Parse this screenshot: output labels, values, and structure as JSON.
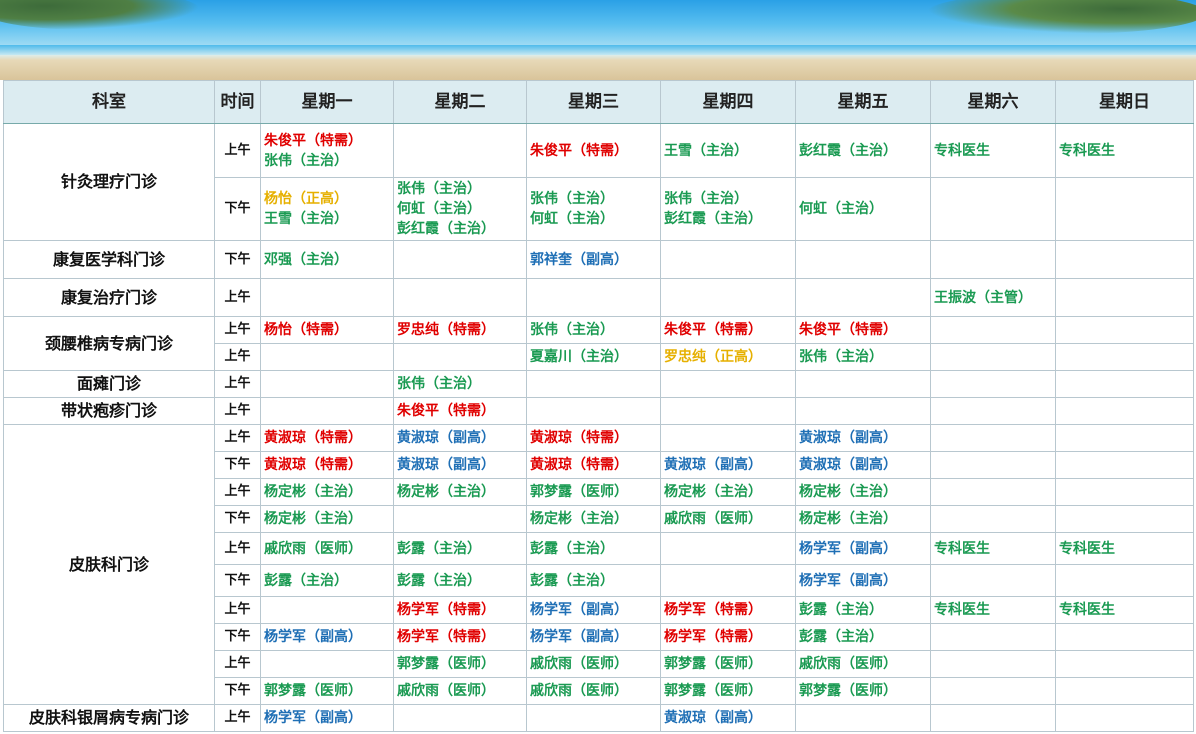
{
  "headers": [
    "科室",
    "时间",
    "星期一",
    "星期二",
    "星期三",
    "星期四",
    "星期五",
    "星期六",
    "星期日"
  ],
  "colors": {
    "red": "#e00000",
    "green": "#1a9a52",
    "blue": "#1f6fb5",
    "gold": "#e6b000",
    "header_bg": "#dcecf1"
  },
  "rows": [
    {
      "dept": "针灸理疗门诊",
      "span": 2,
      "time": "上午",
      "h": 54,
      "cells": [
        [
          [
            "朱俊平（特需）",
            "red"
          ],
          [
            "张伟（主治）",
            "green"
          ]
        ],
        [],
        [
          [
            "朱俊平（特需）",
            "red"
          ]
        ],
        [
          [
            "王雪（主治）",
            "green"
          ]
        ],
        [
          [
            "彭红霞（主治）",
            "green"
          ]
        ],
        [
          [
            "专科医生",
            "green"
          ]
        ],
        [
          [
            "专科医生",
            "green"
          ]
        ]
      ]
    },
    {
      "time": "下午",
      "h": 63,
      "cells": [
        [
          [
            "杨怡（正高）",
            "gold"
          ],
          [
            "王雪（主治）",
            "green"
          ]
        ],
        [
          [
            "张伟（主治）",
            "green"
          ],
          [
            "何虹（主治）",
            "green"
          ],
          [
            "彭红霞（主治）",
            "green"
          ]
        ],
        [
          [
            "张伟（主治）",
            "green"
          ],
          [
            "何虹（主治）",
            "green"
          ]
        ],
        [
          [
            "张伟（主治）",
            "green"
          ],
          [
            "彭红霞（主治）",
            "green"
          ]
        ],
        [
          [
            "何虹（主治）",
            "green"
          ]
        ],
        [],
        []
      ]
    },
    {
      "dept": "康复医学科门诊",
      "span": 1,
      "time": "下午",
      "h": 38,
      "cells": [
        [
          [
            "邓强（主治）",
            "green"
          ]
        ],
        [],
        [
          [
            "郭祥奎（副高）",
            "blue"
          ]
        ],
        [],
        [],
        [],
        []
      ]
    },
    {
      "dept": "康复治疗门诊",
      "span": 1,
      "time": "上午",
      "h": 38,
      "cells": [
        [],
        [],
        [],
        [],
        [],
        [
          [
            "王振波（主管）",
            "green"
          ]
        ],
        []
      ]
    },
    {
      "dept": "颈腰椎病专病门诊",
      "span": 2,
      "time": "上午",
      "h": 27,
      "cells": [
        [
          [
            "杨怡（特需）",
            "red"
          ]
        ],
        [
          [
            "罗忠纯（特需）",
            "red"
          ]
        ],
        [
          [
            "张伟（主治）",
            "green"
          ]
        ],
        [
          [
            "朱俊平（特需）",
            "red"
          ]
        ],
        [
          [
            "朱俊平（特需）",
            "red"
          ]
        ],
        [],
        []
      ]
    },
    {
      "time": "上午",
      "h": 27,
      "cells": [
        [],
        [],
        [
          [
            "夏嘉川（主治）",
            "green"
          ]
        ],
        [
          [
            "罗忠纯（正高）",
            "gold"
          ]
        ],
        [
          [
            "张伟（主治）",
            "green"
          ]
        ],
        [],
        []
      ]
    },
    {
      "dept": "面瘫门诊",
      "span": 1,
      "time": "上午",
      "h": 27,
      "cells": [
        [],
        [
          [
            "张伟（主治）",
            "green"
          ]
        ],
        [],
        [],
        [],
        [],
        []
      ]
    },
    {
      "dept": "带状疱疹门诊",
      "span": 1,
      "time": "上午",
      "h": 27,
      "cells": [
        [],
        [
          [
            "朱俊平（特需）",
            "red"
          ]
        ],
        [],
        [],
        [],
        [],
        []
      ]
    },
    {
      "dept": "皮肤科门诊",
      "span": 10,
      "time": "上午",
      "h": 27,
      "cells": [
        [
          [
            "黄淑琼（特需）",
            "red"
          ]
        ],
        [
          [
            "黄淑琼（副高）",
            "blue"
          ]
        ],
        [
          [
            "黄淑琼（特需）",
            "red"
          ]
        ],
        [],
        [
          [
            "黄淑琼（副高）",
            "blue"
          ]
        ],
        [],
        []
      ]
    },
    {
      "time": "下午",
      "h": 27,
      "cells": [
        [
          [
            "黄淑琼（特需）",
            "red"
          ]
        ],
        [
          [
            "黄淑琼（副高）",
            "blue"
          ]
        ],
        [
          [
            "黄淑琼（特需）",
            "red"
          ]
        ],
        [
          [
            "黄淑琼（副高）",
            "blue"
          ]
        ],
        [
          [
            "黄淑琼（副高）",
            "blue"
          ]
        ],
        [],
        []
      ]
    },
    {
      "time": "上午",
      "h": 27,
      "cells": [
        [
          [
            "杨定彬（主治）",
            "green"
          ]
        ],
        [
          [
            "杨定彬（主治）",
            "green"
          ]
        ],
        [
          [
            "郭梦露（医师）",
            "green"
          ]
        ],
        [
          [
            "杨定彬（主治）",
            "green"
          ]
        ],
        [
          [
            "杨定彬（主治）",
            "green"
          ]
        ],
        [],
        []
      ]
    },
    {
      "time": "下午",
      "h": 27,
      "cells": [
        [
          [
            "杨定彬（主治）",
            "green"
          ]
        ],
        [],
        [
          [
            "杨定彬（主治）",
            "green"
          ]
        ],
        [
          [
            "戚欣雨（医师）",
            "green"
          ]
        ],
        [
          [
            "杨定彬（主治）",
            "green"
          ]
        ],
        [],
        []
      ]
    },
    {
      "time": "上午",
      "h": 32,
      "cells": [
        [
          [
            "戚欣雨（医师）",
            "green"
          ]
        ],
        [
          [
            "彭露（主治）",
            "green"
          ]
        ],
        [
          [
            "彭露（主治）",
            "green"
          ]
        ],
        [],
        [
          [
            "杨学军（副高）",
            "blue"
          ]
        ],
        [
          [
            "专科医生",
            "green"
          ]
        ],
        [
          [
            "专科医生",
            "green"
          ]
        ]
      ]
    },
    {
      "time": "下午",
      "h": 32,
      "cells": [
        [
          [
            "彭露（主治）",
            "green"
          ]
        ],
        [
          [
            "彭露（主治）",
            "green"
          ]
        ],
        [
          [
            "彭露（主治）",
            "green"
          ]
        ],
        [],
        [
          [
            "杨学军（副高）",
            "blue"
          ]
        ],
        [],
        []
      ]
    },
    {
      "time": "上午",
      "h": 27,
      "cells": [
        [],
        [
          [
            "杨学军（特需）",
            "red"
          ]
        ],
        [
          [
            "杨学军（副高）",
            "blue"
          ]
        ],
        [
          [
            "杨学军（特需）",
            "red"
          ]
        ],
        [
          [
            "彭露（主治）",
            "green"
          ]
        ],
        [
          [
            "专科医生",
            "green"
          ]
        ],
        [
          [
            "专科医生",
            "green"
          ]
        ]
      ]
    },
    {
      "time": "下午",
      "h": 27,
      "cells": [
        [
          [
            "杨学军（副高）",
            "blue"
          ]
        ],
        [
          [
            "杨学军（特需）",
            "red"
          ]
        ],
        [
          [
            "杨学军（副高）",
            "blue"
          ]
        ],
        [
          [
            "杨学军（特需）",
            "red"
          ]
        ],
        [
          [
            "彭露（主治）",
            "green"
          ]
        ],
        [],
        []
      ]
    },
    {
      "time": "上午",
      "h": 27,
      "cells": [
        [],
        [
          [
            "郭梦露（医师）",
            "green"
          ]
        ],
        [
          [
            "戚欣雨（医师）",
            "green"
          ]
        ],
        [
          [
            "郭梦露（医师）",
            "green"
          ]
        ],
        [
          [
            "戚欣雨（医师）",
            "green"
          ]
        ],
        [],
        []
      ]
    },
    {
      "time": "下午",
      "h": 27,
      "cells": [
        [
          [
            "郭梦露（医师）",
            "green"
          ]
        ],
        [
          [
            "戚欣雨（医师）",
            "green"
          ]
        ],
        [
          [
            "戚欣雨（医师）",
            "green"
          ]
        ],
        [
          [
            "郭梦露（医师）",
            "green"
          ]
        ],
        [
          [
            "郭梦露（医师）",
            "green"
          ]
        ],
        [],
        []
      ]
    },
    {
      "dept": "皮肤科银屑病专病门诊",
      "span": 1,
      "time": "上午",
      "h": 27,
      "cells": [
        [
          [
            "杨学军（副高）",
            "blue"
          ]
        ],
        [],
        [],
        [
          [
            "黄淑琼（副高）",
            "blue"
          ]
        ],
        [],
        [],
        []
      ]
    }
  ]
}
